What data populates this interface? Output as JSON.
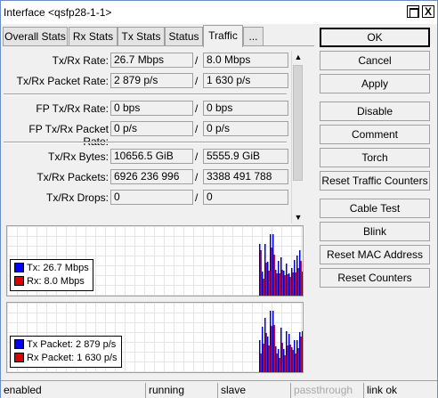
{
  "window": {
    "title": "Interface <qsfp28-1-1>",
    "close_glyph": "X"
  },
  "tabs": [
    {
      "label": "Overall Stats",
      "active": false
    },
    {
      "label": "Rx Stats",
      "active": false
    },
    {
      "label": "Tx Stats",
      "active": false
    },
    {
      "label": "Status",
      "active": false
    },
    {
      "label": "Traffic",
      "active": true
    },
    {
      "label": "...",
      "active": false
    }
  ],
  "traffic": {
    "separator": "/",
    "rows": [
      {
        "label": "Tx/Rx Rate:",
        "tx": "26.7 Mbps",
        "rx": "8.0 Mbps"
      },
      {
        "label": "Tx/Rx Packet Rate:",
        "tx": "2 879 p/s",
        "rx": "1 630 p/s"
      },
      {
        "label": "FP Tx/Rx Rate:",
        "tx": "0 bps",
        "rx": "0 bps"
      },
      {
        "label": "FP Tx/Rx Packet Rate:",
        "tx": "0 p/s",
        "rx": "0 p/s"
      },
      {
        "label": "Tx/Rx Bytes:",
        "tx": "10656.5 GiB",
        "rx": "5555.9 GiB"
      },
      {
        "label": "Tx/Rx Packets:",
        "tx": "6926 236 996",
        "rx": "3388 491 788"
      },
      {
        "label": "Tx/Rx Drops:",
        "tx": "0",
        "rx": "0"
      }
    ]
  },
  "scrollbar": {
    "up_icon": "arrow-up-icon",
    "down_icon": "arrow-down-icon",
    "up_glyph": "▲",
    "down_glyph": "▼"
  },
  "graphs": {
    "tx_color": "#0000ff",
    "rx_color": "#cc0000",
    "bar_color_tx": "#0000cc",
    "bar_color_rx": "#c01040",
    "rate_legend": {
      "tx": "Tx:  26.7 Mbps",
      "rx": "Rx:  8.0 Mbps"
    },
    "packet_legend": {
      "tx": "Tx Packet:  2 879 p/s",
      "rx": "Rx Packet:  1 630 p/s"
    }
  },
  "buttons": {
    "ok": "OK",
    "cancel": "Cancel",
    "apply": "Apply",
    "disable": "Disable",
    "comment": "Comment",
    "torch": "Torch",
    "reset_traffic_counters": "Reset Traffic Counters",
    "cable_test": "Cable Test",
    "blink": "Blink",
    "reset_mac_address": "Reset MAC Address",
    "reset_counters": "Reset Counters"
  },
  "statusbar": {
    "state": "enabled",
    "running": "running",
    "role": "slave",
    "passthrough": "passthrough",
    "link": "link ok"
  }
}
